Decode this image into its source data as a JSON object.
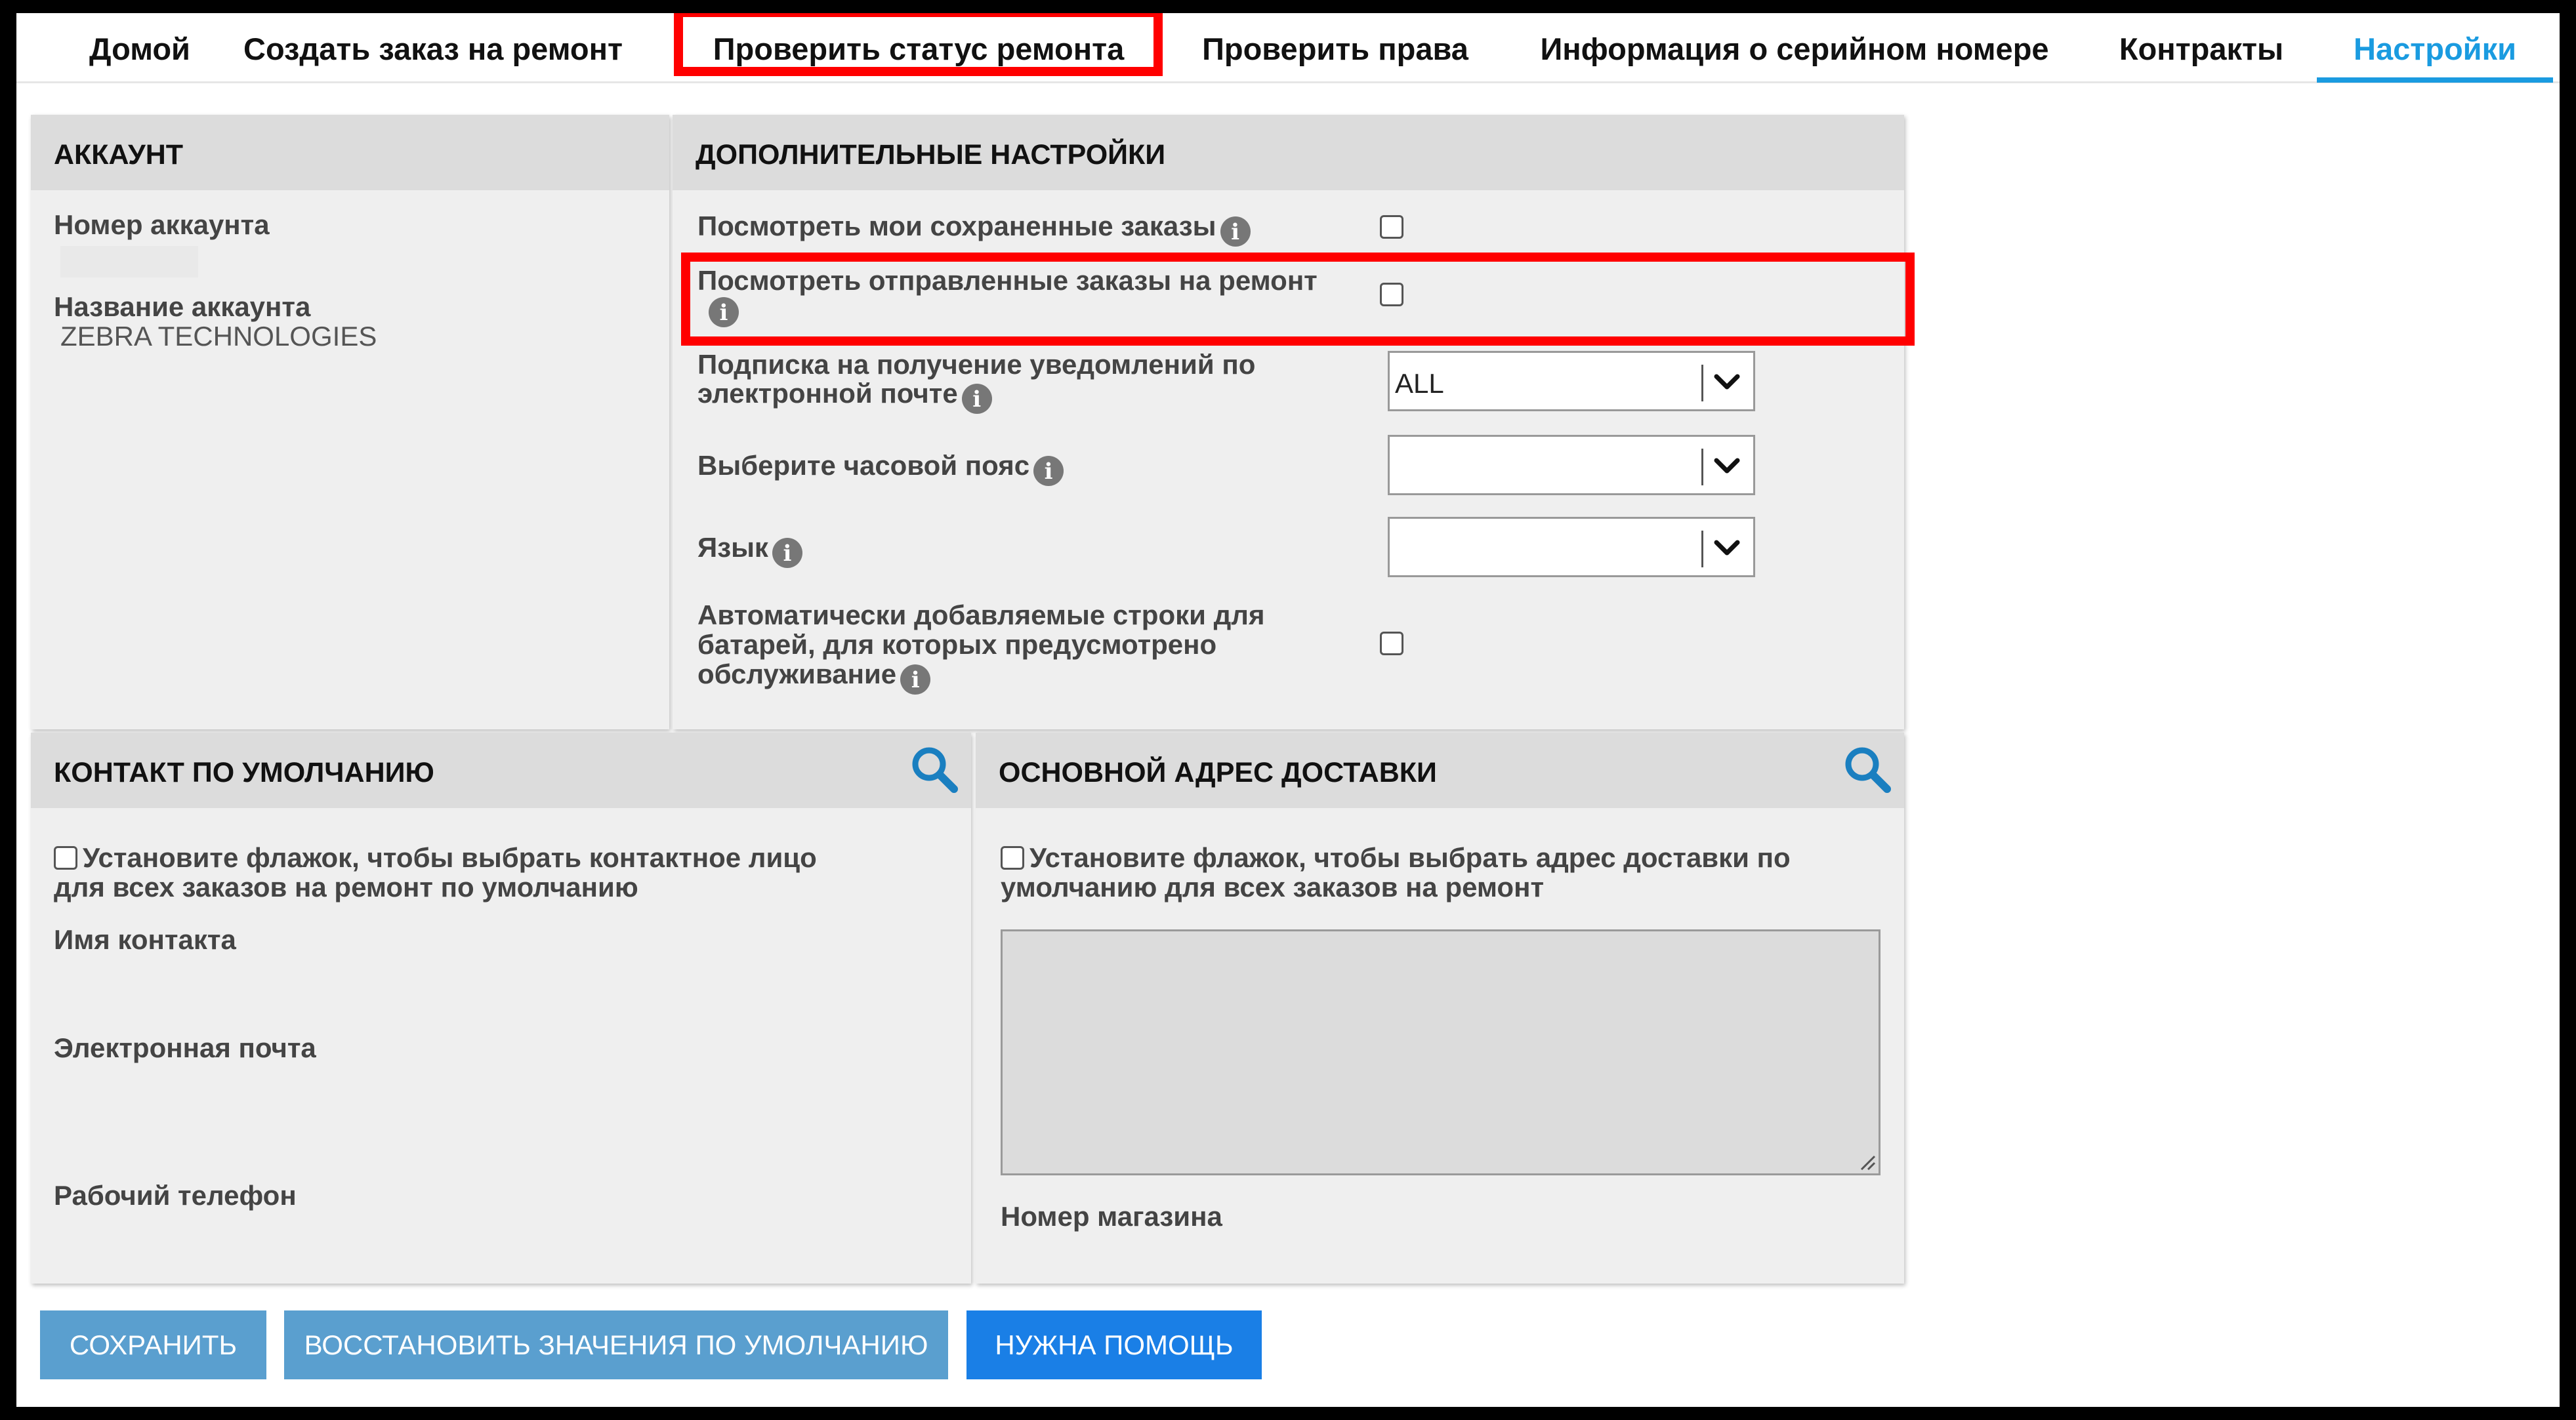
{
  "nav": {
    "tabs": [
      {
        "label": "Домой"
      },
      {
        "label": "Создать заказ на ремонт"
      },
      {
        "label": "Проверить статус ремонта"
      },
      {
        "label": "Проверить права"
      },
      {
        "label": "Информация о серийном номере"
      },
      {
        "label": "Контракты"
      },
      {
        "label": "Настройки"
      }
    ],
    "active": "Настройки"
  },
  "account": {
    "title": "АККАУНТ",
    "number_label": "Номер аккаунта",
    "name_label": "Название аккаунта",
    "name_value": "ZEBRA TECHNOLOGIES"
  },
  "advanced": {
    "title": "ДОПОЛНИТЕЛЬНЫЕ НАСТРОЙКИ",
    "saved_orders_label": "Посмотреть мои сохраненные заказы",
    "sent_orders_label": "Посмотреть отправленные заказы на ремонт",
    "email_sub_label_1": "Подписка на получение уведомлений по",
    "email_sub_label_2": "электронной почте",
    "email_sub_value": "ALL",
    "timezone_label": "Выберите часовой пояс",
    "timezone_value": "",
    "language_label": "Язык",
    "language_value": "",
    "battery_label_1": "Автоматически добавляемые строки для",
    "battery_label_2": "батарей, для которых предусмотрено",
    "battery_label_3": "обслуживание"
  },
  "contact": {
    "title": "КОНТАКТ ПО УМОЛЧАНИЮ",
    "checkbox_text_1": "Установите флажок, чтобы выбрать контактное лицо",
    "checkbox_text_2": "для всех заказов на ремонт по умолчанию",
    "name_label": "Имя контакта",
    "email_label": "Электронная почта",
    "phone_label": "Рабочий телефон"
  },
  "shipping": {
    "title": "ОСНОВНОЙ АДРЕС ДОСТАВКИ",
    "checkbox_text_1": "Установите флажок, чтобы  выбрать адрес доставки по",
    "checkbox_text_2": "умолчанию для всех заказов на ремонт",
    "store_label": "Номер магазина"
  },
  "buttons": {
    "save": "СОХРАНИТЬ",
    "restore": "ВОССТАНОВИТЬ ЗНАЧЕНИЯ ПО УМОЛЧАНИЮ",
    "help": "НУЖНА ПОМОЩЬ"
  },
  "colors": {
    "accent": "#1a9be0",
    "highlight": "#ff0000",
    "button_secondary": "#5a9fcf",
    "button_primary": "#1a7fe6"
  }
}
